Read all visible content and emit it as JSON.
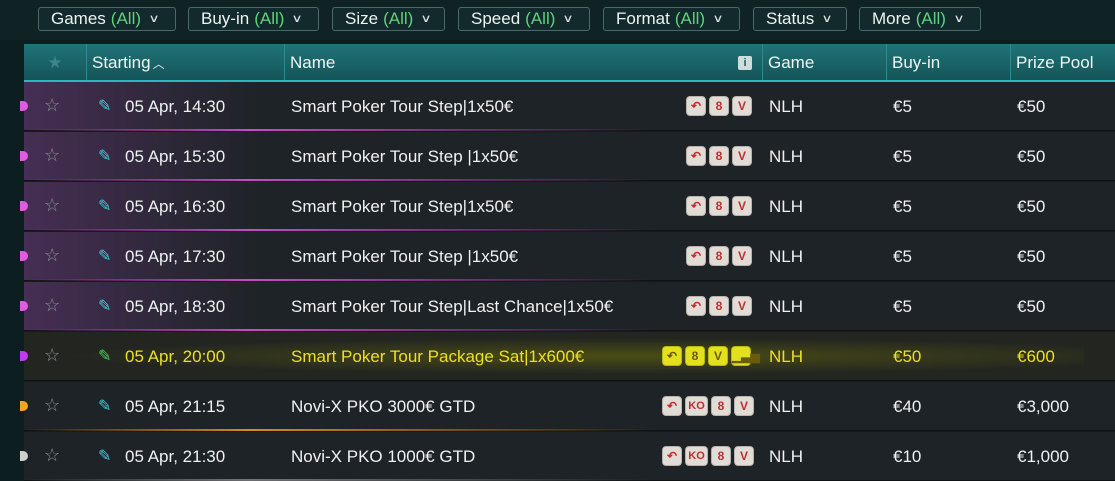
{
  "filters": [
    {
      "label": "Games",
      "value": "(All)"
    },
    {
      "label": "Buy-in",
      "value": "(All)"
    },
    {
      "label": "Size",
      "value": "(All)"
    },
    {
      "label": "Speed",
      "value": "(All)"
    },
    {
      "label": "Format",
      "value": "(All)"
    },
    {
      "label": "Status",
      "value": ""
    },
    {
      "label": "More",
      "value": "(All)"
    }
  ],
  "columns": {
    "favorite_icon": "star-icon",
    "starting": "Starting",
    "name": "Name",
    "game": "Game",
    "buyin": "Buy-in",
    "prize": "Prize Pool",
    "info_glyph": "i"
  },
  "rows": [
    {
      "start": "05 Apr, 14:30",
      "name": "Smart Poker Tour Step|1x50€",
      "badges": [
        "↶",
        "8",
        "V"
      ],
      "game": "NLH",
      "buyin": "€5",
      "prize": "€50"
    },
    {
      "start": "05 Apr, 15:30",
      "name": "Smart Poker Tour Step |1x50€",
      "badges": [
        "↶",
        "8",
        "V"
      ],
      "game": "NLH",
      "buyin": "€5",
      "prize": "€50"
    },
    {
      "start": "05 Apr, 16:30",
      "name": "Smart Poker Tour Step|1x50€",
      "badges": [
        "↶",
        "8",
        "V"
      ],
      "game": "NLH",
      "buyin": "€5",
      "prize": "€50"
    },
    {
      "start": "05 Apr, 17:30",
      "name": "Smart Poker Tour Step |1x50€",
      "badges": [
        "↶",
        "8",
        "V"
      ],
      "game": "NLH",
      "buyin": "€5",
      "prize": "€50"
    },
    {
      "start": "05 Apr, 18:30",
      "name": "Smart Poker Tour Step|Last Chance|1x50€",
      "badges": [
        "↶",
        "8",
        "V"
      ],
      "game": "NLH",
      "buyin": "€5",
      "prize": "€50"
    },
    {
      "start": "05 Apr, 20:00",
      "name": "Smart Poker Tour Package Sat|1x600€",
      "badges": [
        "↶",
        "8",
        "V",
        "▁▃▅"
      ],
      "game": "NLH",
      "buyin": "€50",
      "prize": "€600"
    },
    {
      "start": "05 Apr, 21:15",
      "name": "Novi-X PKO 3000€ GTD",
      "badges": [
        "↶",
        "KO",
        "8",
        "V"
      ],
      "game": "NLH",
      "buyin": "€40",
      "prize": "€3,000"
    },
    {
      "start": "05 Apr, 21:30",
      "name": "Novi-X PKO 1000€ GTD",
      "badges": [
        "↶",
        "KO",
        "8",
        "V"
      ],
      "game": "NLH",
      "buyin": "€10",
      "prize": "€1,000"
    }
  ]
}
